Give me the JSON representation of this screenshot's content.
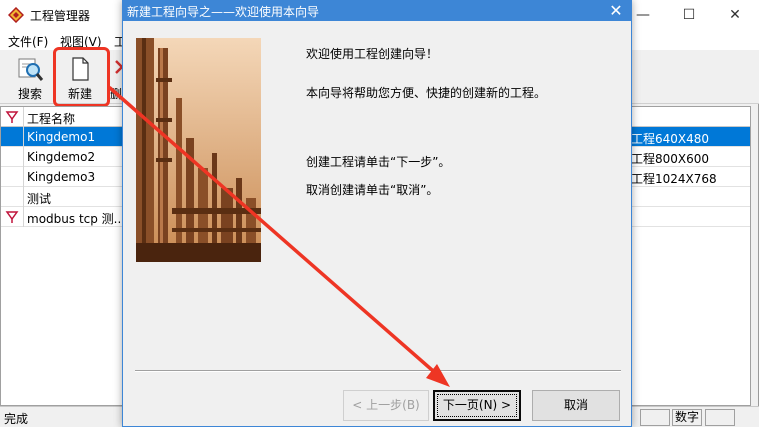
{
  "main_window": {
    "title": "工程管理器",
    "controls": {
      "minimize": "—",
      "maximize": "☐",
      "close": "✕"
    }
  },
  "menubar": {
    "items": [
      "文件(F)",
      "视图(V)",
      "工"
    ]
  },
  "toolbar": {
    "search_label": "搜索",
    "new_label": "新建",
    "delete_label_partial": "删"
  },
  "table": {
    "header_name": "工程名称",
    "rows": [
      {
        "name": "Kingdemo1",
        "desc": "工程640X480",
        "selected": true
      },
      {
        "name": "Kingdemo2",
        "desc": "工程800X600",
        "selected": false
      },
      {
        "name": "Kingdemo3",
        "desc": "工程1024X768",
        "selected": false
      },
      {
        "name": "测试",
        "desc": "",
        "selected": false
      },
      {
        "name": "modbus tcp 测...",
        "desc": "",
        "selected": false
      }
    ]
  },
  "statusbar": {
    "text": "完成",
    "mode": "数字"
  },
  "dialog": {
    "title": "新建工程向导之——欢迎使用本向导",
    "close": "✕",
    "welcome": "欢迎使用工程创建向导！",
    "intro": "本向导将帮助您方便、快捷的创建新的工程。",
    "next_hint": "创建工程请单击“下一步”。",
    "cancel_hint": "取消创建请单击“取消”。",
    "buttons": {
      "prev": "< 上一步(B)",
      "next": "下一页(N) >",
      "cancel": "取消"
    }
  },
  "colors": {
    "annotation": "#ee3524",
    "selection": "#0078d7",
    "dialog_title": "#3d86d6"
  }
}
